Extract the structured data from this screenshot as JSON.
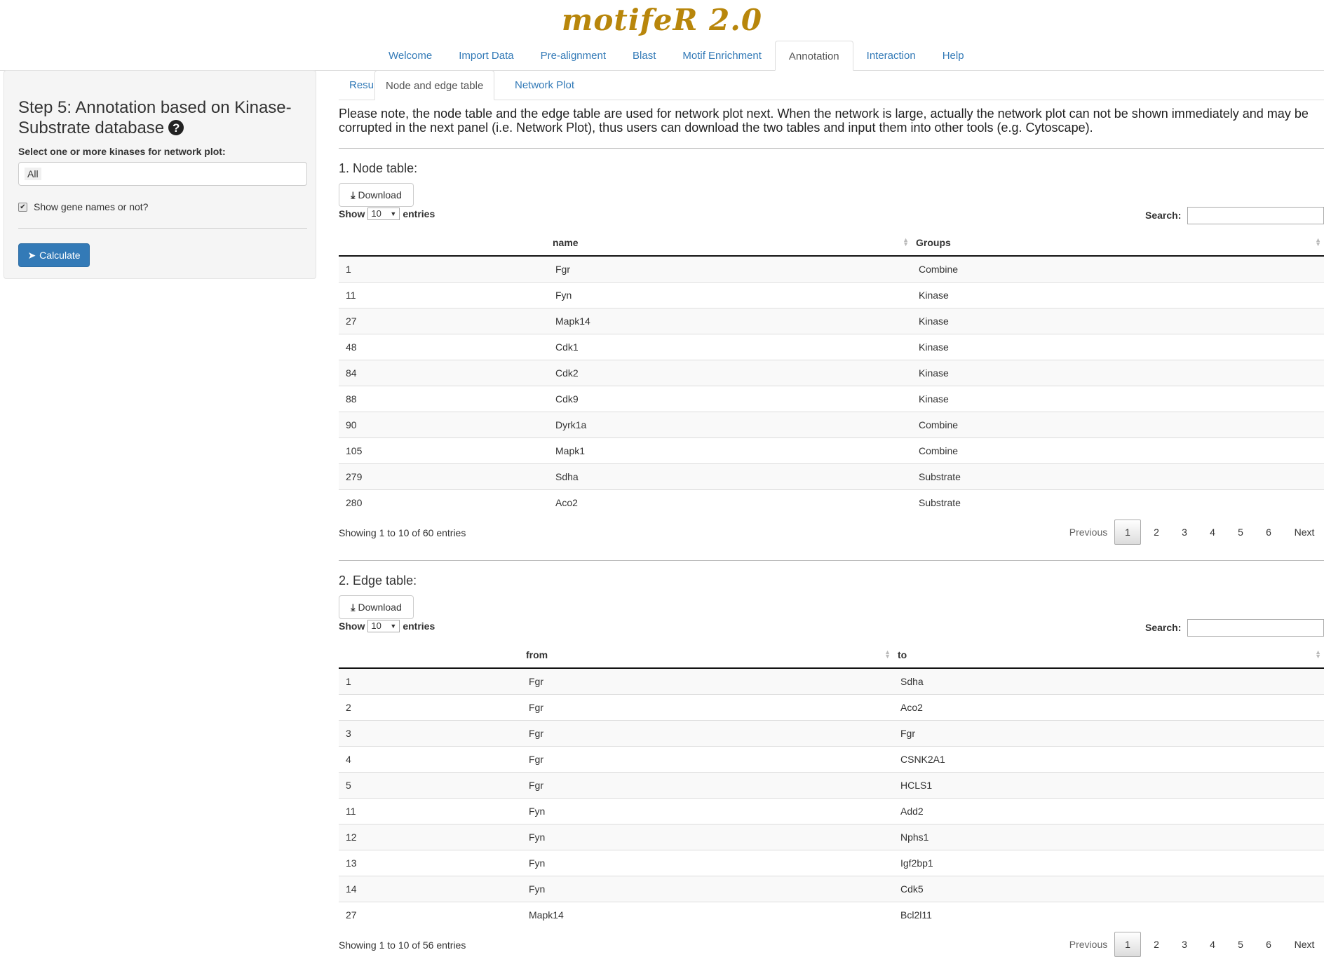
{
  "app": {
    "title": "motifeR 2.0"
  },
  "nav": {
    "tabs": [
      {
        "label": "Welcome"
      },
      {
        "label": "Import Data"
      },
      {
        "label": "Pre-alignment"
      },
      {
        "label": "Blast"
      },
      {
        "label": "Motif Enrichment"
      },
      {
        "label": "Annotation"
      },
      {
        "label": "Interaction"
      },
      {
        "label": "Help"
      }
    ],
    "active": "Annotation"
  },
  "sidebar": {
    "title": "Step 5: Annotation based on Kinase-Substrate database",
    "help_icon": "question-circle-icon",
    "select_label": "Select one or more kinases for network plot:",
    "select_value": "All",
    "checkbox_label": "Show gene names or not?",
    "checkbox_checked": true,
    "calculate_label": "Calculate"
  },
  "subtabs": {
    "tabs": [
      {
        "label": "Results"
      },
      {
        "label": "Node and edge table"
      },
      {
        "label": "Network Plot"
      }
    ],
    "active": "Node and edge table"
  },
  "note": "Please note, the node table and the edge table are used for network plot next. When the network is large, actually the network plot can not be shown immediately and may be corrupted in the next panel (i.e. Network Plot), thus users can download the two tables and input them into other tools (e.g. Cytoscape).",
  "node_table": {
    "title": "1. Node table:",
    "download_label": "Download",
    "show_label": "Show",
    "entries_label": "entries",
    "length_value": "10",
    "search_label": "Search:",
    "columns": [
      "name",
      "Groups"
    ],
    "rows": [
      [
        "1",
        "Fgr",
        "Combine"
      ],
      [
        "11",
        "Fyn",
        "Kinase"
      ],
      [
        "27",
        "Mapk14",
        "Kinase"
      ],
      [
        "48",
        "Cdk1",
        "Kinase"
      ],
      [
        "84",
        "Cdk2",
        "Kinase"
      ],
      [
        "88",
        "Cdk9",
        "Kinase"
      ],
      [
        "90",
        "Dyrk1a",
        "Combine"
      ],
      [
        "105",
        "Mapk1",
        "Combine"
      ],
      [
        "279",
        "Sdha",
        "Substrate"
      ],
      [
        "280",
        "Aco2",
        "Substrate"
      ]
    ],
    "info": "Showing 1 to 10 of 60 entries",
    "pagination": {
      "previous": "Previous",
      "pages": [
        "1",
        "2",
        "3",
        "4",
        "5",
        "6"
      ],
      "current": "1",
      "next": "Next"
    }
  },
  "edge_table": {
    "title": "2. Edge table:",
    "download_label": "Download",
    "show_label": "Show",
    "entries_label": "entries",
    "length_value": "10",
    "search_label": "Search:",
    "columns": [
      "from",
      "to"
    ],
    "rows": [
      [
        "1",
        "Fgr",
        "Sdha"
      ],
      [
        "2",
        "Fgr",
        "Aco2"
      ],
      [
        "3",
        "Fgr",
        "Fgr"
      ],
      [
        "4",
        "Fgr",
        "CSNK2A1"
      ],
      [
        "5",
        "Fgr",
        "HCLS1"
      ],
      [
        "11",
        "Fyn",
        "Add2"
      ],
      [
        "12",
        "Fyn",
        "Nphs1"
      ],
      [
        "13",
        "Fyn",
        "Igf2bp1"
      ],
      [
        "14",
        "Fyn",
        "Cdk5"
      ],
      [
        "27",
        "Mapk14",
        "Bcl2l11"
      ]
    ],
    "info": "Showing 1 to 10 of 56 entries",
    "pagination": {
      "previous": "Previous",
      "pages": [
        "1",
        "2",
        "3",
        "4",
        "5",
        "6"
      ],
      "current": "1",
      "next": "Next"
    }
  },
  "colors": {
    "accent": "#337ab7",
    "brand_title": "#b8860b"
  }
}
